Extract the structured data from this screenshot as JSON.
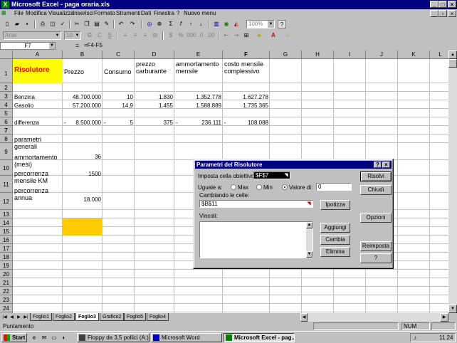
{
  "window": {
    "title": "Microsoft Excel - paga oraria.xls"
  },
  "menu": [
    "File",
    "Modifica",
    "Visualizza",
    "Inserisci",
    "Formato",
    "Strumenti",
    "Dati",
    "Finestra",
    "?",
    "Nuovo menu"
  ],
  "toolbar": {
    "zoom": "100%",
    "font": "Arial",
    "font_size": "10"
  },
  "formula_bar": {
    "cell_ref": "F7",
    "equals": "=",
    "formula": "=F4-F5"
  },
  "columns": [
    "A",
    "B",
    "C",
    "D",
    "E",
    "F",
    "G",
    "H",
    "I",
    "J",
    "K",
    "L"
  ],
  "rows": [
    "1",
    "2",
    "3",
    "4",
    "5",
    "6",
    "7",
    "8",
    "9",
    "10",
    "11",
    "12",
    "13",
    "14",
    "15",
    "16",
    "17",
    "18",
    "19",
    "20",
    "21",
    "22",
    "23",
    "24",
    "25"
  ],
  "cells": {
    "A1": "Risolutore",
    "B1": "Prezzo",
    "C1": "Consumo",
    "D1": "prezzo carburante",
    "E1": "ammortamento mensile",
    "F1": "costo mensile complessivo",
    "A4": "Benzina",
    "B4": "48.700.000",
    "C4": "10",
    "D4": "1.830",
    "E4": "1.352.778",
    "F4": "1.627.278",
    "A5": "Gasolio",
    "B5": "57.200.000",
    "C5": "14,9",
    "D5": "1.455",
    "E5": "1.588.889",
    "F5": "1.735.365",
    "A7": "differenza",
    "B7_sign": "-",
    "B7": "8.500.000",
    "C7_sign": "-",
    "C7": "5",
    "D7": "375",
    "E7_sign": "-",
    "E7": "236.111",
    "F7_sign": "-",
    "F7": "108.088",
    "A9": "parametri generali",
    "A10": "ammortamento (mesi)",
    "B10": "36",
    "A11": "percorrenza mensile KM",
    "B11": "1500",
    "A12": "percorrenza annua",
    "B12": "18.000"
  },
  "colors": {
    "highlight_yellow": "#ffff00",
    "orange": "#ffcc00",
    "selected_blue": "#99ccff",
    "title_blue": "#000080",
    "red_text": "#ff0000"
  },
  "sheet_tabs": [
    "Foglio1",
    "Foglio2",
    "Foglio3",
    "Grafico2",
    "Foglio5",
    "Foglio4"
  ],
  "active_tab": "Foglio3",
  "status": {
    "text": "Puntamento",
    "num": "NUM"
  },
  "taskbar": {
    "start": "Start",
    "tasks": [
      "Floppy da 3,5 pollici (A:)",
      "Microsoft Word",
      "Microsoft Excel - pag..."
    ],
    "time": "11.24"
  },
  "dialog": {
    "title": "Parametri del Risolutore",
    "target_label": "Imposta cella obiettivo:",
    "target_value": "$F$7",
    "equal_label": "Uguale a:",
    "max_label": "Max",
    "min_label": "Min",
    "value_label": "Valore di:",
    "value_input": "0",
    "changing_label": "Cambiando le celle:",
    "changing_value": "$B$11",
    "constraints_label": "Vincoli:",
    "buttons": {
      "solve": "Risolvi",
      "close": "Chiudi",
      "guess": "Ipotizza",
      "options": "Opzioni",
      "add": "Aggiungi",
      "change": "Cambia",
      "delete": "Elimina",
      "reset": "Reimposta",
      "help": "?"
    }
  }
}
